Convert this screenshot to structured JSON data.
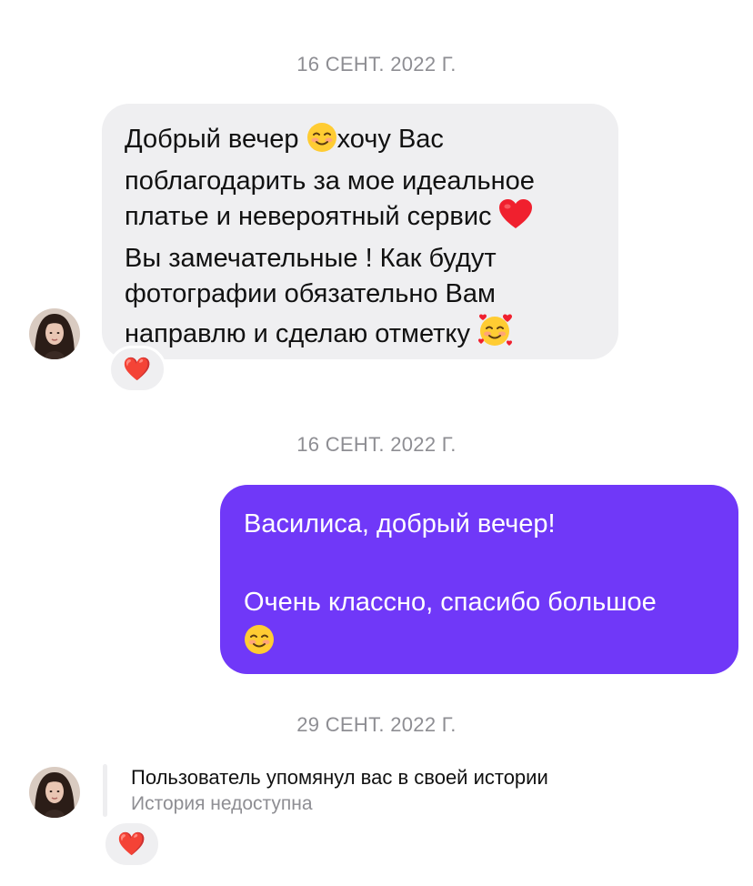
{
  "dates": [
    "16 СЕНТ. 2022 Г.",
    "16 СЕНТ. 2022 Г.",
    "29 СЕНТ. 2022 Г."
  ],
  "incoming_message": {
    "lines": [
      "Добрый вечер",
      "хочу Вас",
      "поблагодарить за мое идеальное",
      "платье и невероятный сервис",
      "Вы замечательные ! Как будут",
      "фотографии обязательно Вам",
      "направлю и сделаю отметку"
    ],
    "emojis": [
      "smiling-face-icon",
      "red-heart-icon",
      "smiling-face-with-hearts-icon"
    ],
    "reaction": "❤️"
  },
  "outgoing_message": {
    "lines": [
      "Василиса, добрый вечер!",
      "",
      "Очень классно, спасибо большое"
    ],
    "emoji": "smiling-face-icon"
  },
  "story_mention": {
    "title": "Пользователь упомянул вас в своей истории",
    "subtitle": "История недоступна",
    "reaction": "❤️"
  },
  "colors": {
    "incoming_bubble": "#efeff1",
    "outgoing_bubble": "#7038f8",
    "date_text": "#8e8e93",
    "heart": "#ff2d3b"
  }
}
